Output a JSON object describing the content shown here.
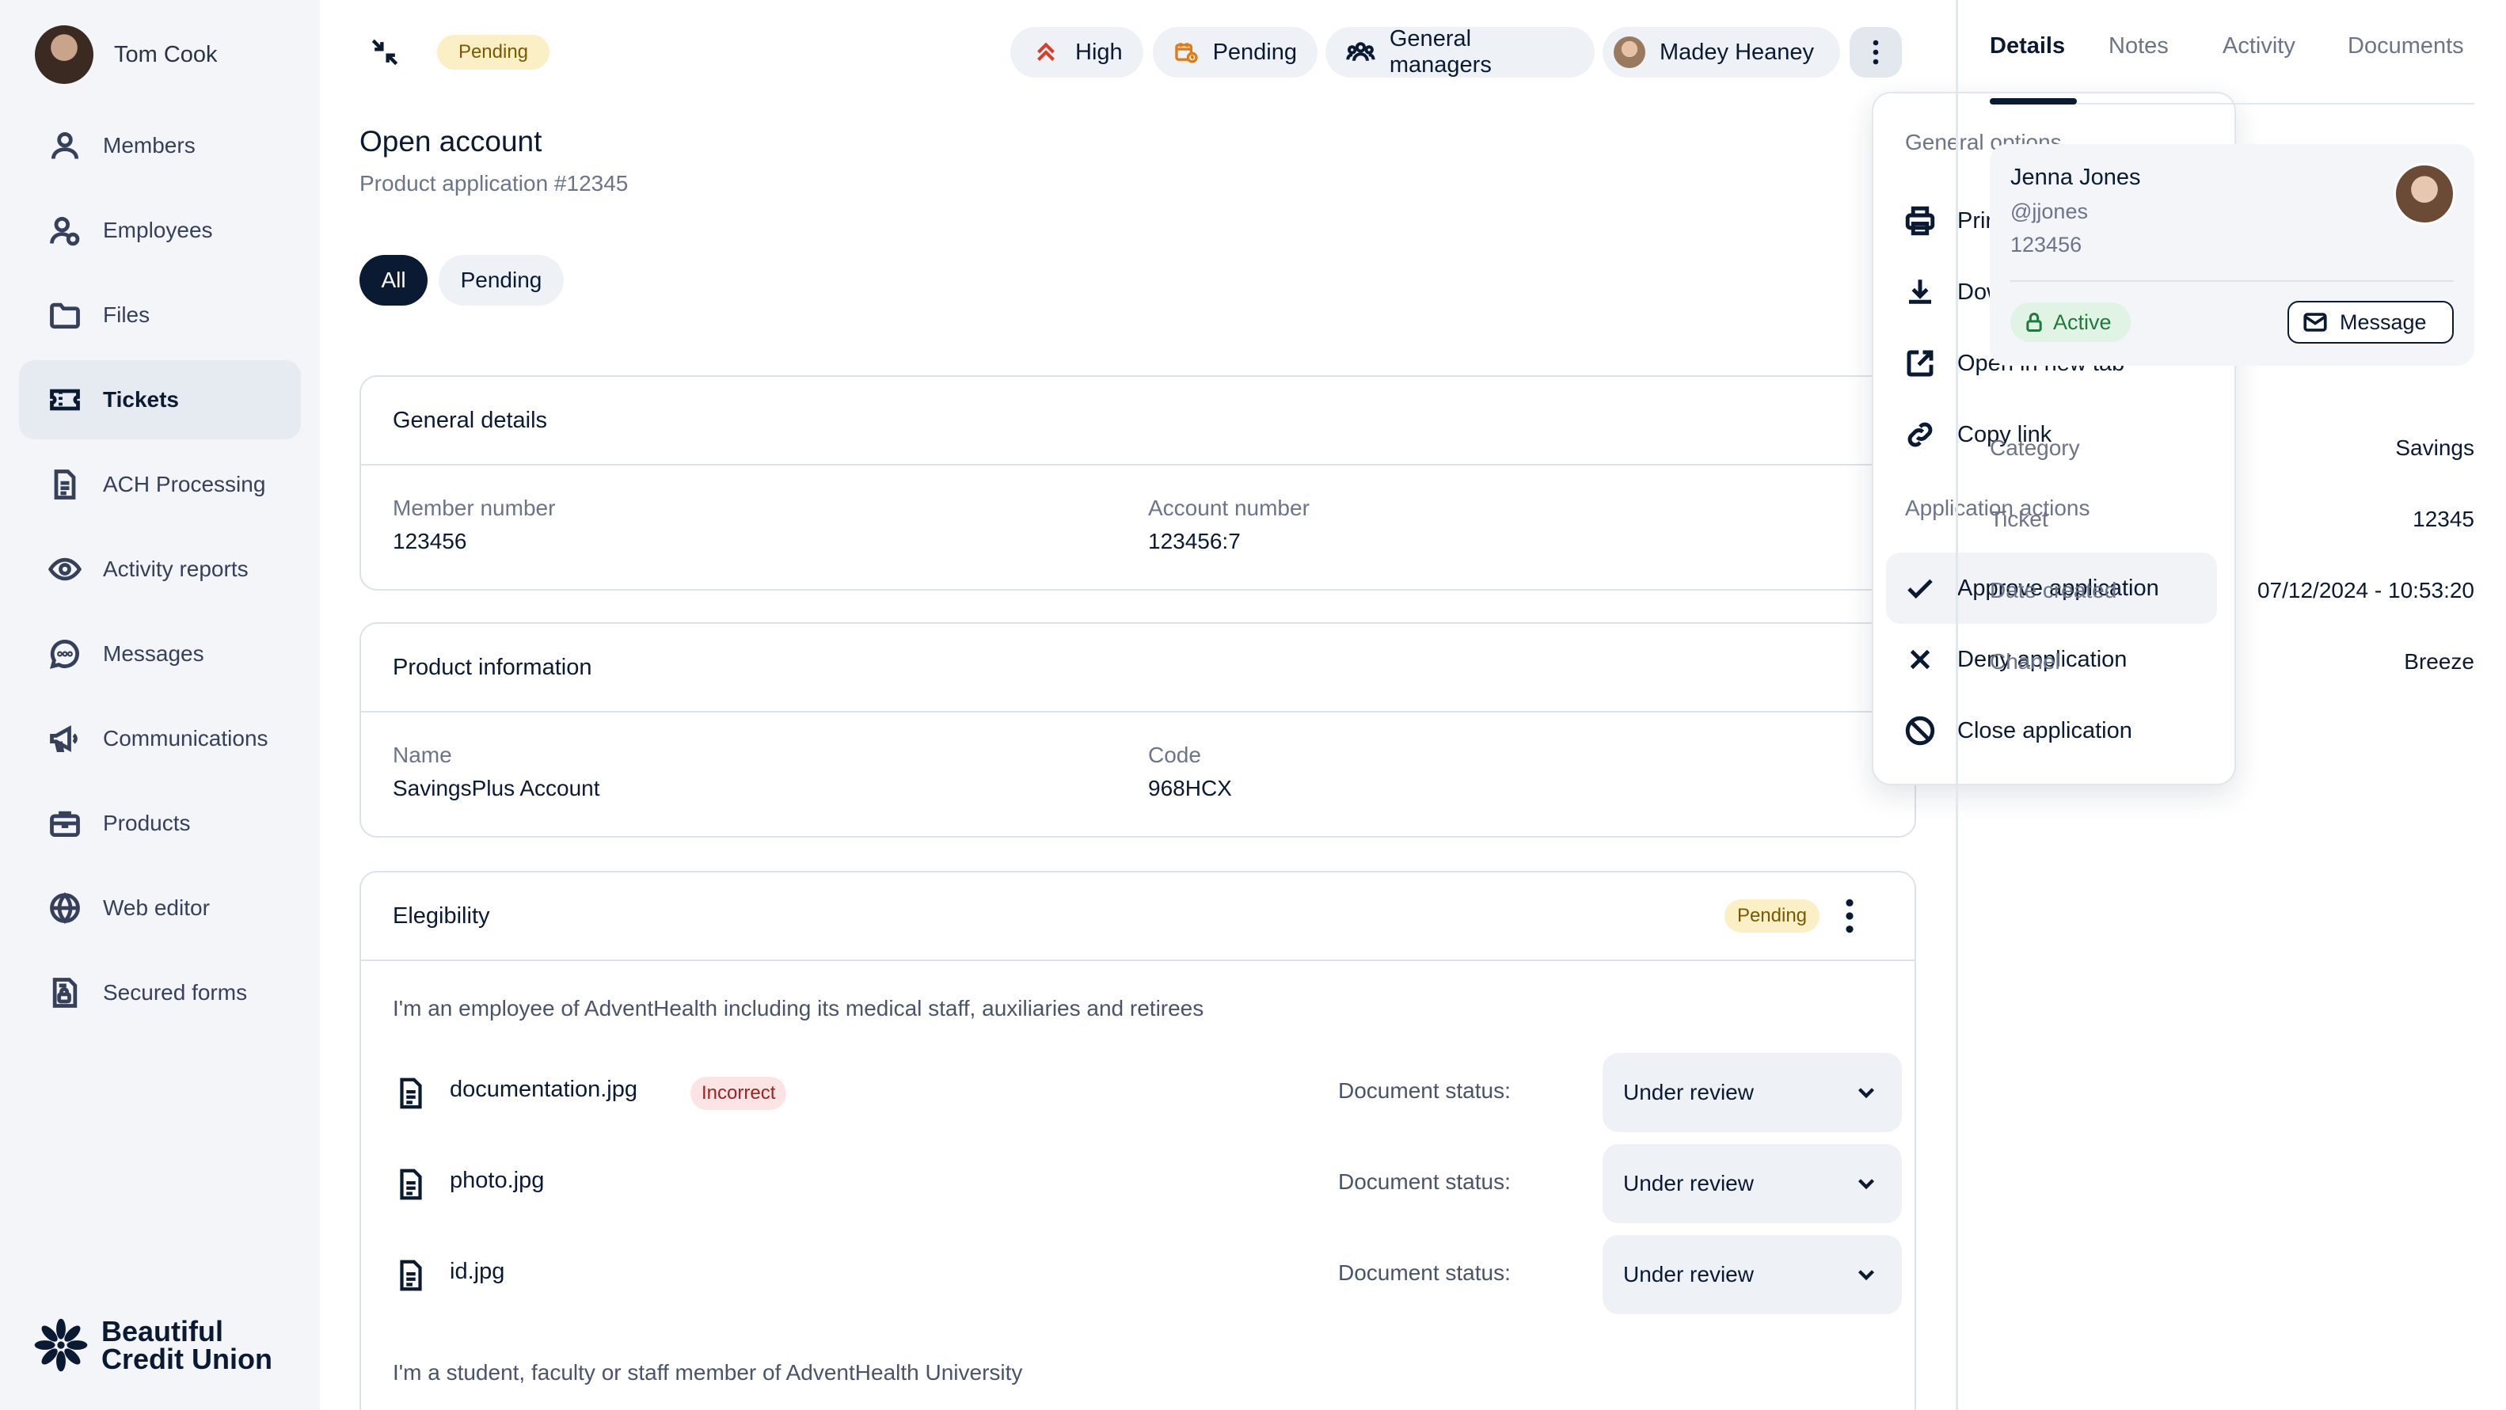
{
  "user": {
    "name": "Tom Cook"
  },
  "sidebar": {
    "items": [
      {
        "label": "Members",
        "icon": "user-icon"
      },
      {
        "label": "Employees",
        "icon": "users-icon"
      },
      {
        "label": "Files",
        "icon": "folder-icon"
      },
      {
        "label": "Tickets",
        "icon": "ticket-icon",
        "active": true
      },
      {
        "label": "ACH Processing",
        "icon": "document-icon"
      },
      {
        "label": "Activity reports",
        "icon": "eye-icon"
      },
      {
        "label": "Messages",
        "icon": "chat-icon"
      },
      {
        "label": "Communications",
        "icon": "megaphone-icon"
      },
      {
        "label": "Products",
        "icon": "briefcase-icon"
      },
      {
        "label": "Web editor",
        "icon": "globe-icon"
      },
      {
        "label": "Secured forms",
        "icon": "secured-form-icon"
      }
    ],
    "logo": {
      "line1": "Beautiful",
      "line2": "Credit Union"
    }
  },
  "topbar": {
    "status_badge": "Pending",
    "priority_label": "High",
    "status_label": "Pending",
    "group_label": "General managers",
    "assignee_label": "Madey Heaney"
  },
  "header": {
    "title": "Open account",
    "subtitle": "Product application #12345",
    "filters": [
      "All",
      "Pending"
    ]
  },
  "general_details": {
    "title": "General details",
    "member_number_label": "Member number",
    "member_number": "123456",
    "account_number_label": "Account number",
    "account_number": "123456:7"
  },
  "product_information": {
    "title": "Product information",
    "name_label": "Name",
    "name": "SavingsPlus Account",
    "code_label": "Code",
    "code": "968HCX"
  },
  "eligibility": {
    "title": "Elegibility",
    "status": "Pending",
    "statement1": "I'm an employee of AdventHealth including its medical staff, auxiliaries and retirees",
    "statement2": "I'm a student, faculty or staff member of AdventHealth University",
    "document_status_label": "Document status:",
    "documents": [
      {
        "name": "documentation.jpg",
        "tag": "Incorrect",
        "status": "Under review"
      },
      {
        "name": "photo.jpg",
        "tag": "",
        "status": "Under review"
      },
      {
        "name": "id.jpg",
        "tag": "",
        "status": "Under review"
      }
    ]
  },
  "menu": {
    "general_title": "General options",
    "general": [
      "Print",
      "Download report",
      "Open in new tab",
      "Copy link"
    ],
    "actions_title": "Application actions",
    "actions": [
      "Approve application",
      "Deny application",
      "Close application"
    ]
  },
  "right_panel": {
    "tabs": [
      "Details",
      "Notes",
      "Activity",
      "Documents"
    ],
    "contact": {
      "name": "Jenna Jones",
      "handle": "@jjones",
      "id": "123456",
      "status": "Active",
      "message_label": "Message"
    },
    "details": [
      {
        "key": "Category",
        "value": "Savings"
      },
      {
        "key": "Ticket",
        "value": "12345"
      },
      {
        "key": "Date created",
        "value": "07/12/2024 - 10:53:20"
      },
      {
        "key": "Chanel",
        "value": "Breeze"
      }
    ]
  },
  "colors": {
    "brand_dark": "#0b1a33",
    "pending_bg": "#fbefc6",
    "incorrect_bg": "#fde4e4",
    "active_bg": "#e1f3e5",
    "priority_high": "#d6402b",
    "pending_icon": "#e07b1a"
  }
}
